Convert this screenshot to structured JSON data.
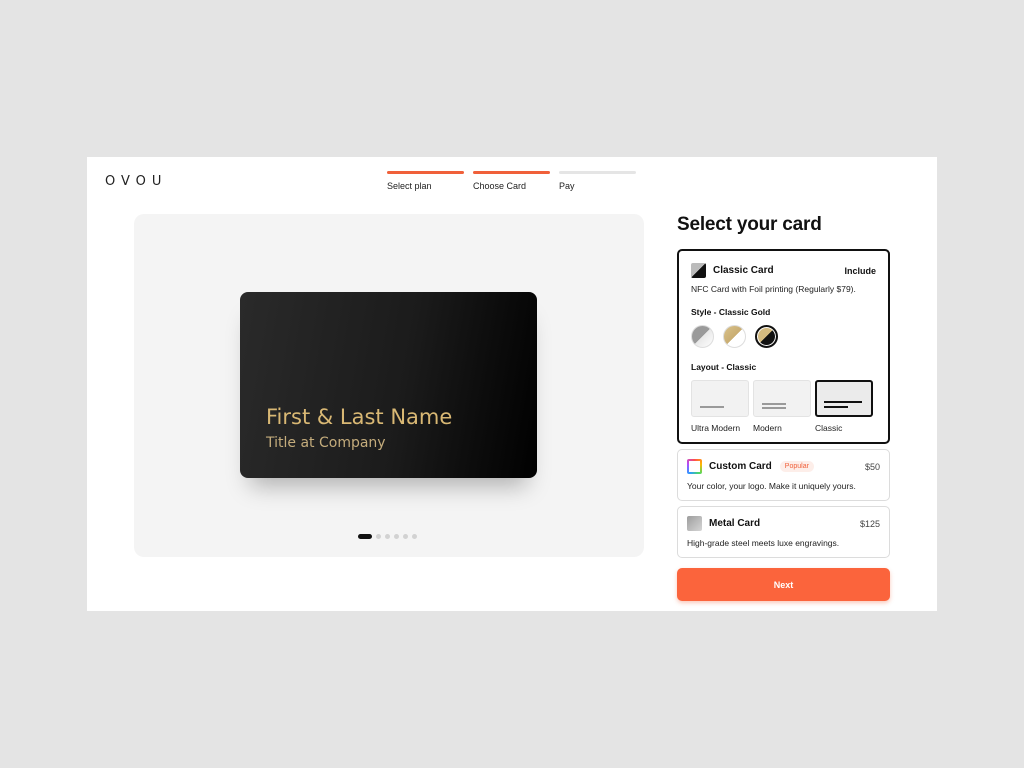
{
  "brand": {
    "logo": "OVOU"
  },
  "steps": [
    {
      "label": "Select plan",
      "done": true
    },
    {
      "label": "Choose Card",
      "done": true
    },
    {
      "label": "Pay",
      "done": false
    }
  ],
  "preview": {
    "card_name": "First & Last Name",
    "card_title": "Title at Company",
    "carousel_pages": 6,
    "carousel_active": 1
  },
  "panel": {
    "title": "Select your card",
    "options": [
      {
        "name": "Classic Card",
        "price": "Include",
        "description": "NFC Card with Foil printing (Regularly $79).",
        "style_label": "Style - Classic Gold",
        "layout_label": "Layout - Classic",
        "layouts": [
          "Ultra Modern",
          "Modern",
          "Classic"
        ],
        "selected_layout": "Classic",
        "styles": [
          "silver",
          "gold",
          "classic-gold"
        ],
        "selected_style": "classic-gold"
      },
      {
        "name": "Custom Card",
        "badge": "Popular",
        "price": "$50",
        "description": "Your color, your logo. Make it uniquely yours."
      },
      {
        "name": "Metal Card",
        "price": "$125",
        "description": "High-grade steel meets luxe engravings."
      }
    ],
    "next_label": "Next"
  },
  "colors": {
    "accent": "#fb643c",
    "card_gold": "#d9b874",
    "background": "#e4e4e4"
  }
}
